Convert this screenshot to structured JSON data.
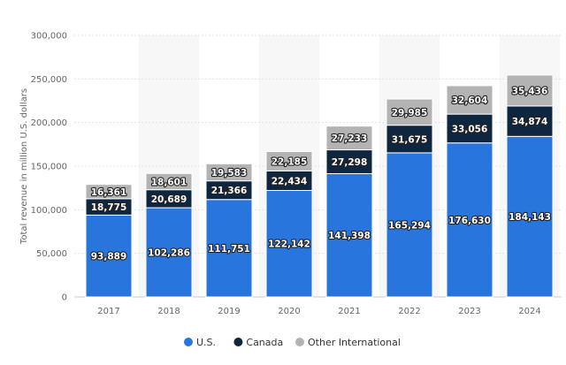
{
  "chart_data": {
    "type": "bar",
    "stacked": true,
    "title": "",
    "xlabel": "",
    "ylabel": "Total revenue in million U.S. dollars",
    "ylim": [
      0,
      300000
    ],
    "yticks": [
      0,
      50000,
      100000,
      150000,
      200000,
      250000,
      300000
    ],
    "ytick_labels": [
      "0",
      "50,000",
      "100,000",
      "150,000",
      "200,000",
      "250,000",
      "300,000"
    ],
    "grid": true,
    "legend_position": "bottom",
    "categories": [
      "2017",
      "2018",
      "2019",
      "2020",
      "2021",
      "2022",
      "2023",
      "2024"
    ],
    "series": [
      {
        "name": "U.S.",
        "color": "#2876dd",
        "values": [
          93889,
          102286,
          111751,
          122142,
          141398,
          165294,
          176630,
          184143
        ],
        "labels": [
          "93,889",
          "102,286",
          "111,751",
          "122,142",
          "141,398",
          "165,294",
          "176,630",
          "184,143"
        ]
      },
      {
        "name": "Canada",
        "color": "#0f2640",
        "values": [
          18775,
          20689,
          21366,
          22434,
          27298,
          31675,
          33056,
          34874
        ],
        "labels": [
          "18,775",
          "20,689",
          "21,366",
          "22,434",
          "27,298",
          "31,675",
          "33,056",
          "34,874"
        ]
      },
      {
        "name": "Other International",
        "color": "#b3b3b3",
        "values": [
          16361,
          18601,
          19583,
          22185,
          27233,
          29985,
          32604,
          35436
        ],
        "labels": [
          "16,361",
          "18,601",
          "19,583",
          "22,185",
          "27,233",
          "29,985",
          "32,604",
          "35,436"
        ]
      }
    ]
  }
}
